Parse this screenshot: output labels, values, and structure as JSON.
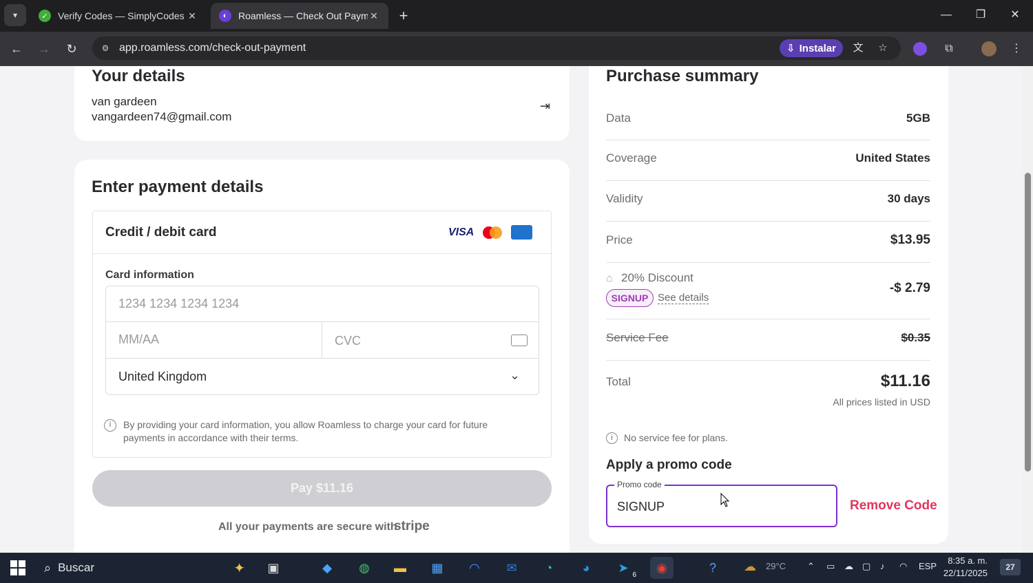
{
  "browser": {
    "tabs": [
      {
        "title": "Verify Codes — SimplyCodes"
      },
      {
        "title": "Roamless — Check Out Paymen"
      }
    ],
    "url": "app.roamless.com/check-out-payment",
    "install_label": "Instalar"
  },
  "details": {
    "title": "Your details",
    "name": "van gardeen",
    "email": "vangardeen74@gmail.com"
  },
  "payment": {
    "title": "Enter payment details",
    "method_label": "Credit / debit card",
    "brands": [
      "VISA",
      "mastercard",
      "amex"
    ],
    "card_info_label": "Card information",
    "card_number_placeholder": "1234 1234 1234 1234",
    "expiry_placeholder": "MM/AA",
    "cvc_placeholder": "CVC",
    "country": "United Kingdom",
    "consent_text_line1": "By providing your card information, you allow Roamless to charge your card for future",
    "consent_text_line2": "payments in accordance with their terms.",
    "pay_button_label": "Pay $11.16",
    "secure_text": "All your payments are secure with",
    "secure_brand": "stripe"
  },
  "summary": {
    "title": "Purchase summary",
    "rows": [
      {
        "label": "Data",
        "value": "5GB"
      },
      {
        "label": "Coverage",
        "value": "United States"
      },
      {
        "label": "Validity",
        "value": "30 days"
      },
      {
        "label": "Price",
        "value": "$13.95"
      }
    ],
    "discount_label": "20% Discount",
    "discount_code": "SIGNUP",
    "see_details": "See details",
    "discount_value": "-$ 2.79",
    "service_fee_label": "Service Fee",
    "service_fee_value": "$0.35",
    "total_label": "Total",
    "total_value": "$11.16",
    "currency_note": "All prices listed in USD",
    "no_fee_note": "No service fee for plans.",
    "promo_title": "Apply a promo code",
    "promo_field_label": "Promo code",
    "promo_value": "SIGNUP",
    "remove_code": "Remove Code"
  },
  "taskbar": {
    "search_label": "Buscar",
    "weather": "29°C",
    "language": "ESP",
    "time": "8:35 a. m.",
    "date": "22/11/2025",
    "notifications": "27",
    "telegram_badge": "6"
  },
  "colors": {
    "accent_purple": "#7b2fd0",
    "remove_red": "#e0365f",
    "discount_purple": "#9b3fb0"
  }
}
